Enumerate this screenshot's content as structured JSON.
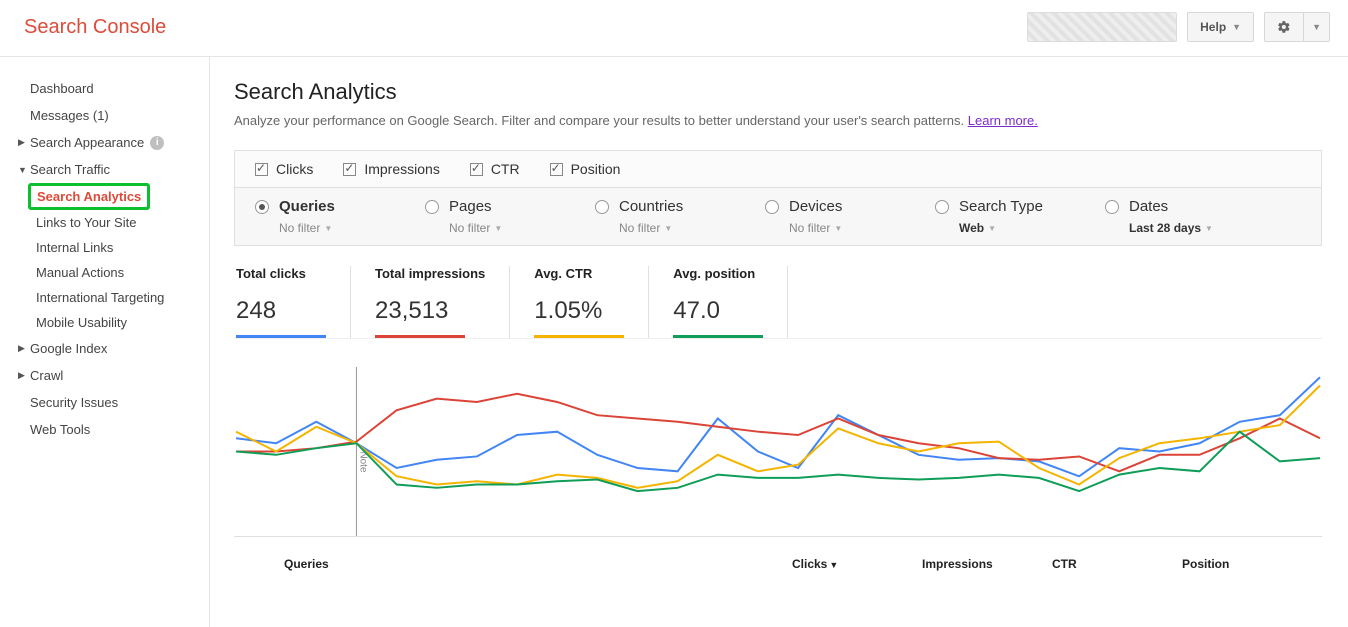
{
  "header": {
    "brand": "Search Console",
    "help_label": "Help"
  },
  "sidebar": {
    "dashboard": "Dashboard",
    "messages": "Messages (1)",
    "search_appearance": "Search Appearance",
    "search_traffic": "Search Traffic",
    "traffic_children": {
      "search_analytics": "Search Analytics",
      "links_to_site": "Links to Your Site",
      "internal_links": "Internal Links",
      "manual_actions": "Manual Actions",
      "intl_targeting": "International Targeting",
      "mobile_usability": "Mobile Usability"
    },
    "google_index": "Google Index",
    "crawl": "Crawl",
    "security": "Security Issues",
    "web_tools": "Web Tools"
  },
  "page": {
    "title": "Search Analytics",
    "subtitle_a": "Analyze your performance on Google Search. Filter and compare your results to better understand your user's search patterns. ",
    "learn_more": "Learn more."
  },
  "filters": {
    "metrics": {
      "clicks": "Clicks",
      "impressions": "Impressions",
      "ctr": "CTR",
      "position": "Position"
    },
    "dimensions": {
      "queries": {
        "label": "Queries",
        "sub": "No filter"
      },
      "pages": {
        "label": "Pages",
        "sub": "No filter"
      },
      "countries": {
        "label": "Countries",
        "sub": "No filter"
      },
      "devices": {
        "label": "Devices",
        "sub": "No filter"
      },
      "searchtype": {
        "label": "Search Type",
        "sub": "Web"
      },
      "dates": {
        "label": "Dates",
        "sub": "Last 28 days"
      }
    }
  },
  "metrics": {
    "clicks": {
      "label": "Total clicks",
      "value": "248"
    },
    "impressions": {
      "label": "Total impressions",
      "value": "23,513"
    },
    "ctr": {
      "label": "Avg. CTR",
      "value": "1.05%"
    },
    "position": {
      "label": "Avg. position",
      "value": "47.0"
    }
  },
  "table": {
    "col_queries": "Queries",
    "col_clicks": "Clicks",
    "col_impr": "Impressions",
    "col_ctr": "CTR",
    "col_pos": "Position"
  },
  "chart_data": {
    "type": "line",
    "note_label": "Note",
    "note_x_index": 3,
    "x": [
      0,
      1,
      2,
      3,
      4,
      5,
      6,
      7,
      8,
      9,
      10,
      11,
      12,
      13,
      14,
      15,
      16,
      17,
      18,
      19,
      20,
      21,
      22,
      23,
      24,
      25,
      26,
      27
    ],
    "ylim": [
      0,
      100
    ],
    "series": [
      {
        "name": "Clicks",
        "color": "#4285f4",
        "values": [
          58,
          55,
          68,
          55,
          40,
          45,
          47,
          60,
          62,
          48,
          40,
          38,
          70,
          50,
          40,
          72,
          60,
          48,
          45,
          46,
          44,
          35,
          52,
          50,
          55,
          68,
          72,
          95
        ]
      },
      {
        "name": "Impressions",
        "color": "#db4437",
        "values": [
          50,
          50,
          52,
          56,
          75,
          82,
          80,
          85,
          80,
          72,
          70,
          68,
          65,
          62,
          60,
          70,
          60,
          55,
          52,
          46,
          45,
          47,
          38,
          48,
          48,
          58,
          70,
          58
        ]
      },
      {
        "name": "CTR",
        "color": "#f4b400",
        "values": [
          62,
          50,
          65,
          55,
          35,
          30,
          32,
          30,
          36,
          34,
          28,
          32,
          48,
          38,
          42,
          64,
          55,
          50,
          55,
          56,
          40,
          30,
          46,
          55,
          58,
          62,
          66,
          90
        ]
      },
      {
        "name": "Position",
        "color": "#0f9d58",
        "values": [
          50,
          48,
          52,
          55,
          30,
          28,
          30,
          30,
          32,
          33,
          26,
          28,
          36,
          34,
          34,
          36,
          34,
          33,
          34,
          36,
          34,
          26,
          36,
          40,
          38,
          62,
          44,
          46
        ]
      }
    ]
  }
}
